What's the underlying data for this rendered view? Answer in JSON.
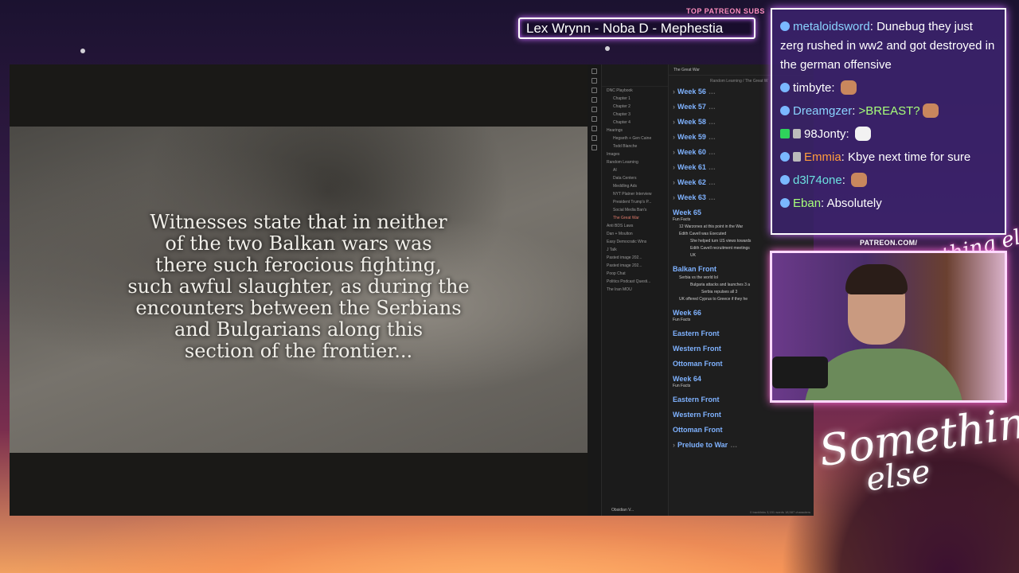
{
  "overlay": {
    "patreon_label": "TOP PATREON SUBS",
    "patreon_names": "Lex Wrynn -  Noba D - Mephestia",
    "cam_label": "PATREON.COM/",
    "cam_sign": "Anything else?",
    "logo_line1": "Something",
    "logo_line2": "else"
  },
  "video": {
    "caption_lines": [
      "Witnesses state that in neither",
      "of the two Balkan wars was",
      "there such ferocious fighting,",
      "such awful slaughter, as during the",
      "encounters between the Serbians",
      "and Bulgarians along this",
      "section of the frontier..."
    ]
  },
  "obsidian": {
    "tab_title": "The Great War",
    "breadcrumb": "Random Learning  /  The Great W",
    "vault_name": "Obsidian V...",
    "tree": [
      {
        "label": "DNC Playbook",
        "level": 0
      },
      {
        "label": "Chapter 1",
        "level": 1
      },
      {
        "label": "Chapter 2",
        "level": 1
      },
      {
        "label": "Chapter 3",
        "level": 1
      },
      {
        "label": "Chapter 4",
        "level": 1
      },
      {
        "label": "Hearings",
        "level": 0
      },
      {
        "label": "Hegseth + Gen Caine",
        "level": 1
      },
      {
        "label": "Todd Blanche",
        "level": 1
      },
      {
        "label": "Images",
        "level": 0
      },
      {
        "label": "Random Learning",
        "level": 0
      },
      {
        "label": "AI",
        "level": 1
      },
      {
        "label": "Data Centers",
        "level": 1
      },
      {
        "label": "Meddling Ads",
        "level": 1
      },
      {
        "label": "NYT Platner Interview",
        "level": 1
      },
      {
        "label": "President Trump's P...",
        "level": 1
      },
      {
        "label": "Social Media Ban's",
        "level": 1
      },
      {
        "label": "The Great War",
        "level": 1,
        "active": true
      },
      {
        "label": "Anti BDS Laws",
        "level": 0
      },
      {
        "label": "Dan + Moulton",
        "level": 0
      },
      {
        "label": "Easy Democratic Wins",
        "level": 0
      },
      {
        "label": "J Talk",
        "level": 0
      },
      {
        "label": "Pasted image 202...",
        "level": 0
      },
      {
        "label": "Pasted image 202...",
        "level": 0
      },
      {
        "label": "Poop Chat",
        "level": 0
      },
      {
        "label": "Politics Podcast Questi...",
        "level": 0
      },
      {
        "label": "The Iran MOU",
        "level": 0
      }
    ],
    "weeks_collapsed": [
      "Week 56",
      "Week 57",
      "Week 58",
      "Week 59",
      "Week 60",
      "Week 61",
      "Week 62",
      "Week 63"
    ],
    "week65": {
      "heading": "Week 65",
      "sub": "Fun Facts",
      "items": [
        {
          "text": "12 Warzones at this point in the War",
          "level": 1
        },
        {
          "text": "Edith Cavell was Executed",
          "level": 1
        },
        {
          "text": "She helped turn US views towards",
          "level": 2
        },
        {
          "text": "Edith Cavell recruitment meetings",
          "level": 2
        },
        {
          "text": "UK",
          "level": 2
        }
      ]
    },
    "balkan": {
      "heading": "Balkan Front",
      "items": [
        {
          "text": "Serbia vs the world lol",
          "level": 1
        },
        {
          "text": "Bulgaria attacks and launches 3 a",
          "level": 2
        },
        {
          "text": "Serbia repulses all 3",
          "level": 3
        },
        {
          "text": "UK offered Cyprus to Greece if they he",
          "level": 1
        }
      ]
    },
    "week66": {
      "heading": "Week 66",
      "sub": "Fun Facts",
      "fronts": [
        "Eastern Front",
        "Western Front",
        "Ottoman Front"
      ]
    },
    "week64": {
      "heading": "Week 64",
      "sub": "Fun Facts",
      "fronts": [
        "Eastern Front",
        "Western Front",
        "Ottoman Front"
      ]
    },
    "prelude": "Prelude to War",
    "status": "0 backlinks   3,151 words  18,587 characters"
  },
  "chat": {
    "messages": [
      {
        "user": "metaloidsword",
        "color": "blue",
        "text": "Dunebug they just zerg rushed in ww2 and got destroyed in the german offensive",
        "emote": false
      },
      {
        "user": "timbyte",
        "color": "white",
        "text": "",
        "emote": true
      },
      {
        "user": "Dreamgzer",
        "color": "blue",
        "text": ">BREAST?",
        "emote": true
      },
      {
        "user": "98Jonty",
        "color": "white",
        "text": "",
        "emote": true
      },
      {
        "user": "Emmia",
        "color": "orange",
        "text": "Kbye next time for sure",
        "emote": false
      },
      {
        "user": "d3l74one",
        "color": "teal",
        "text": "",
        "emote": true
      },
      {
        "user": "Eban",
        "color": "green",
        "text": "Absolutely",
        "emote": false
      }
    ]
  }
}
